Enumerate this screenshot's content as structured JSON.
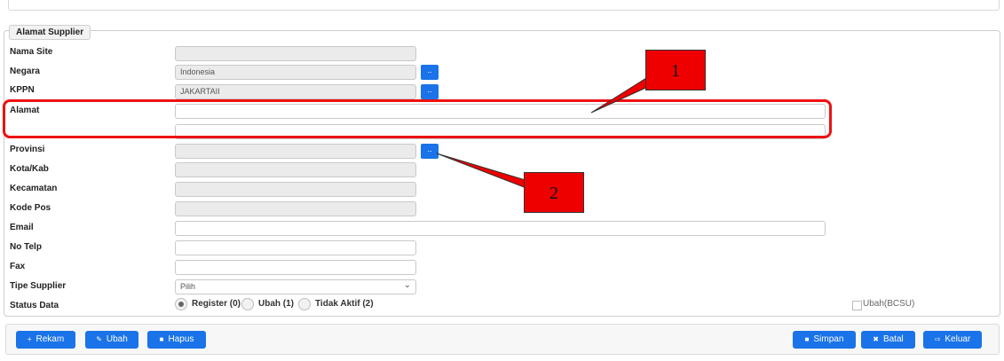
{
  "section_title": "Alamat Supplier",
  "fields": {
    "nama_site": {
      "label": "Nama Site",
      "value": ""
    },
    "negara": {
      "label": "Negara",
      "value": "Indonesia"
    },
    "kppn": {
      "label": "KPPN",
      "value": "JAKARTAII"
    },
    "alamat": {
      "label": "Alamat",
      "line1": "",
      "line2": ""
    },
    "provinsi": {
      "label": "Provinsi",
      "value": ""
    },
    "kota_kab": {
      "label": "Kota/Kab",
      "value": ""
    },
    "kecamatan": {
      "label": "Kecamatan",
      "value": ""
    },
    "kode_pos": {
      "label": "Kode Pos",
      "value": ""
    },
    "email": {
      "label": "Email",
      "value": ""
    },
    "no_telp": {
      "label": "No Telp",
      "value": ""
    },
    "fax": {
      "label": "Fax",
      "value": ""
    },
    "tipe_supplier": {
      "label": "Tipe Supplier",
      "selected": "Pilih"
    },
    "status_data": {
      "label": "Status Data",
      "options": [
        "Register (0)",
        "Ubah (1)",
        "Tidak Aktif (2)"
      ],
      "selected": "Register (0)"
    }
  },
  "lookup_button_label": "..",
  "ubah_bcsu_label": "Ubah(BCSU)",
  "actions": {
    "rekam": "Rekam",
    "ubah": "Ubah",
    "hapus": "Hapus",
    "simpan": "Simpan",
    "batal": "Batal",
    "keluar": "Keluar"
  },
  "annotations": {
    "marker1": "1",
    "marker2": "2"
  },
  "colors": {
    "primary_button": "#1a73e8",
    "highlight": "#ee1111",
    "marker_fill": "#ee0000"
  }
}
